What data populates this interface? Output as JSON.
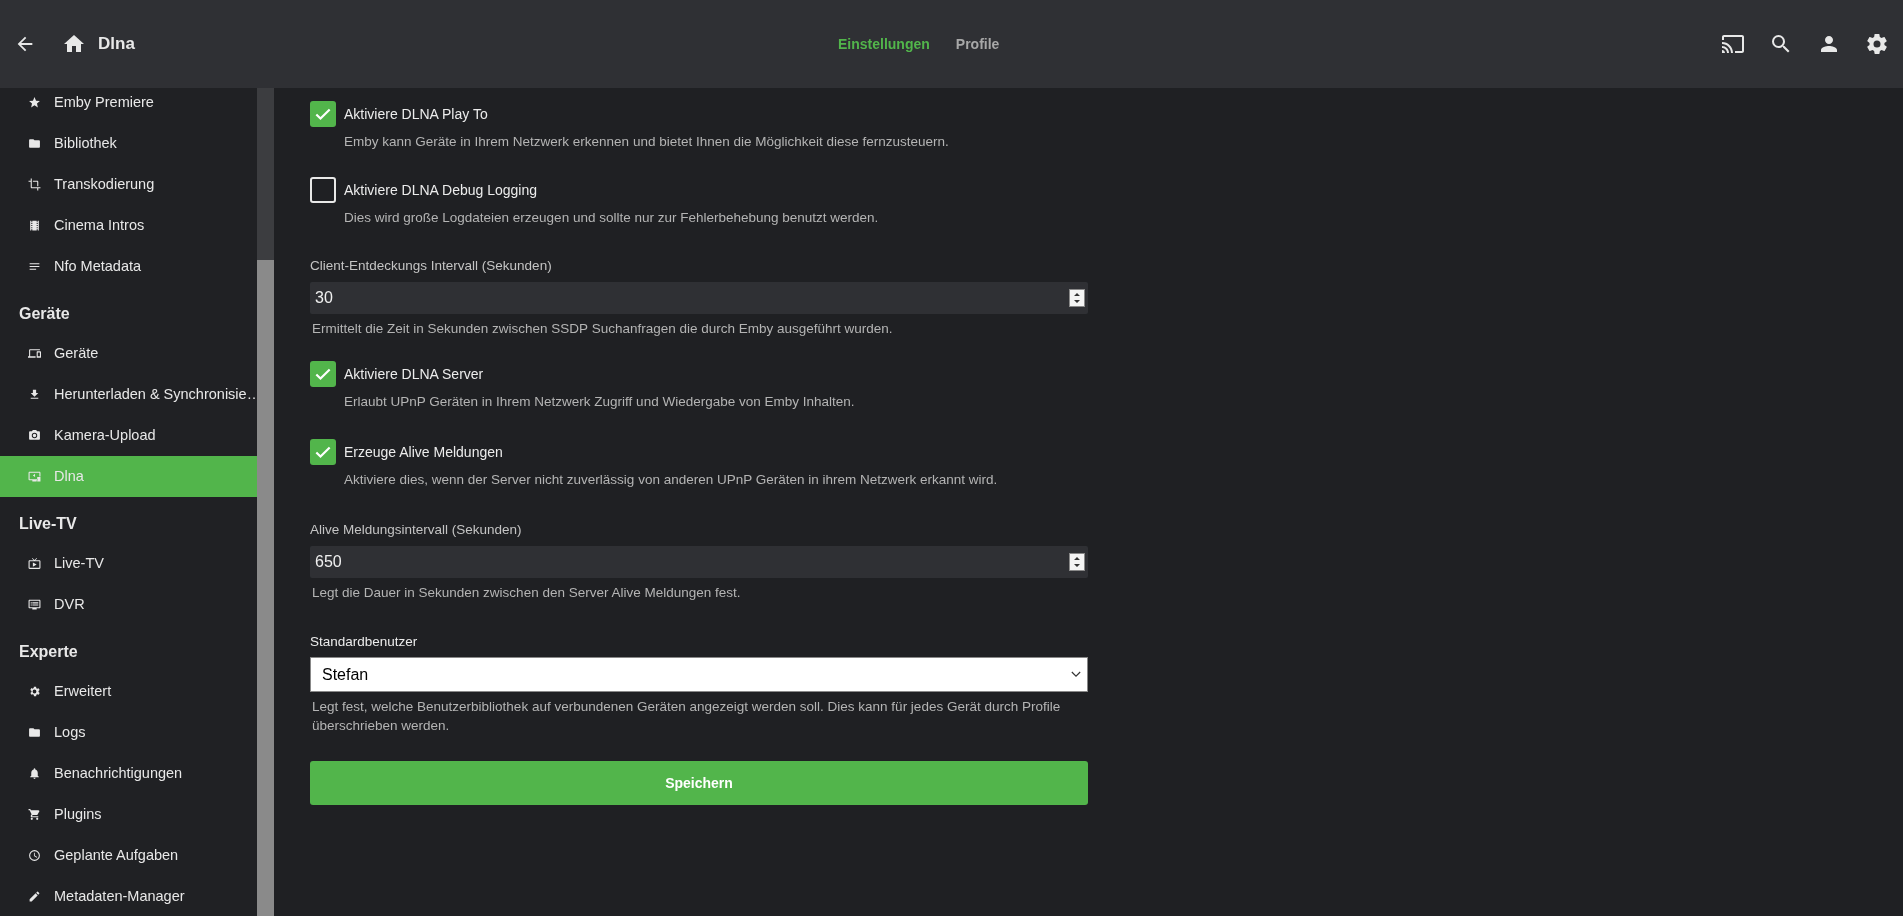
{
  "header": {
    "title": "Dlna",
    "tabs": [
      {
        "label": "Einstellungen",
        "selected": true
      },
      {
        "label": "Profile",
        "selected": false
      }
    ]
  },
  "sidebar": {
    "items": [
      {
        "kind": "item",
        "label": "Emby Premiere",
        "selected": false
      },
      {
        "kind": "item",
        "label": "Bibliothek",
        "selected": false
      },
      {
        "kind": "item",
        "label": "Transkodierung",
        "selected": false
      },
      {
        "kind": "item",
        "label": "Cinema Intros",
        "selected": false
      },
      {
        "kind": "item",
        "label": "Nfo Metadata",
        "selected": false
      },
      {
        "kind": "heading",
        "label": "Geräte"
      },
      {
        "kind": "item",
        "label": "Geräte",
        "selected": false
      },
      {
        "kind": "item",
        "label": "Herunterladen & Synchronisie…",
        "selected": false
      },
      {
        "kind": "item",
        "label": "Kamera-Upload",
        "selected": false
      },
      {
        "kind": "item",
        "label": "Dlna",
        "selected": true
      },
      {
        "kind": "heading",
        "label": "Live-TV"
      },
      {
        "kind": "item",
        "label": "Live-TV",
        "selected": false
      },
      {
        "kind": "item",
        "label": "DVR",
        "selected": false
      },
      {
        "kind": "heading",
        "label": "Experte"
      },
      {
        "kind": "item",
        "label": "Erweitert",
        "selected": false
      },
      {
        "kind": "item",
        "label": "Logs",
        "selected": false
      },
      {
        "kind": "item",
        "label": "Benachrichtigungen",
        "selected": false
      },
      {
        "kind": "item",
        "label": "Plugins",
        "selected": false
      },
      {
        "kind": "item",
        "label": "Geplante Aufgaben",
        "selected": false
      },
      {
        "kind": "item",
        "label": "Metadaten-Manager",
        "selected": false
      }
    ]
  },
  "settings": [
    {
      "kind": "checkbox",
      "label": "Aktiviere DLNA Play To",
      "checked": true,
      "description": "Emby kann Geräte in Ihrem Netzwerk erkennen und bietet Ihnen die Möglichkeit diese fernzusteuern."
    },
    {
      "kind": "checkbox",
      "label": "Aktiviere DLNA Debug Logging",
      "checked": false,
      "description": "Dies wird große Logdateien erzeugen und sollte nur zur Fehlerbehebung benutzt werden."
    },
    {
      "kind": "number",
      "label": "Client-Entdeckungs Intervall (Sekunden)",
      "value": "30",
      "description": "Ermittelt die Zeit in Sekunden zwischen SSDP Suchanfragen die durch Emby ausgeführt wurden."
    },
    {
      "kind": "checkbox",
      "label": "Aktiviere DLNA Server",
      "checked": true,
      "description": "Erlaubt UPnP Geräten in Ihrem Netzwerk Zugriff und Wiedergabe von Emby Inhalten."
    },
    {
      "kind": "checkbox",
      "label": "Erzeuge Alive Meldungen",
      "checked": true,
      "description": "Aktiviere dies, wenn der Server nicht zuverlässig von anderen UPnP Geräten in ihrem Netzwerk erkannt wird."
    },
    {
      "kind": "number",
      "label": "Alive Meldungsintervall (Sekunden)",
      "value": "650",
      "description": "Legt die Dauer in Sekunden zwischen den Server Alive Meldungen fest."
    },
    {
      "kind": "select",
      "label": "Standardbenutzer",
      "value": "Stefan",
      "description": "Legt fest, welche Benutzerbibliothek auf verbundenen Geräten angezeigt werden soll. Dies kann für jedes Gerät durch Profile überschrieben werden."
    }
  ],
  "save_button": "Speichern"
}
